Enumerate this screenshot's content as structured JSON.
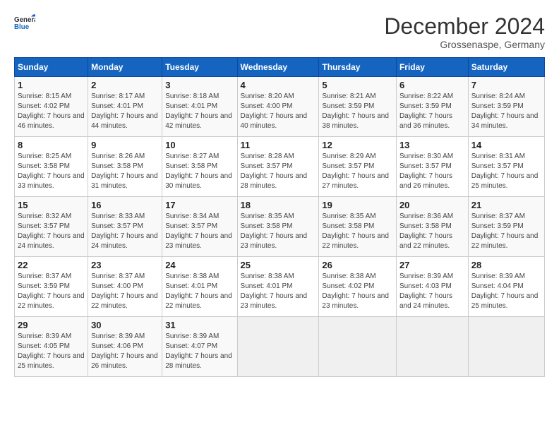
{
  "logo": {
    "text_general": "General",
    "text_blue": "Blue"
  },
  "title": "December 2024",
  "subtitle": "Grossenaspe, Germany",
  "days_of_week": [
    "Sunday",
    "Monday",
    "Tuesday",
    "Wednesday",
    "Thursday",
    "Friday",
    "Saturday"
  ],
  "weeks": [
    [
      {
        "day": "1",
        "sunrise": "Sunrise: 8:15 AM",
        "sunset": "Sunset: 4:02 PM",
        "daylight": "Daylight: 7 hours and 46 minutes."
      },
      {
        "day": "2",
        "sunrise": "Sunrise: 8:17 AM",
        "sunset": "Sunset: 4:01 PM",
        "daylight": "Daylight: 7 hours and 44 minutes."
      },
      {
        "day": "3",
        "sunrise": "Sunrise: 8:18 AM",
        "sunset": "Sunset: 4:01 PM",
        "daylight": "Daylight: 7 hours and 42 minutes."
      },
      {
        "day": "4",
        "sunrise": "Sunrise: 8:20 AM",
        "sunset": "Sunset: 4:00 PM",
        "daylight": "Daylight: 7 hours and 40 minutes."
      },
      {
        "day": "5",
        "sunrise": "Sunrise: 8:21 AM",
        "sunset": "Sunset: 3:59 PM",
        "daylight": "Daylight: 7 hours and 38 minutes."
      },
      {
        "day": "6",
        "sunrise": "Sunrise: 8:22 AM",
        "sunset": "Sunset: 3:59 PM",
        "daylight": "Daylight: 7 hours and 36 minutes."
      },
      {
        "day": "7",
        "sunrise": "Sunrise: 8:24 AM",
        "sunset": "Sunset: 3:59 PM",
        "daylight": "Daylight: 7 hours and 34 minutes."
      }
    ],
    [
      {
        "day": "8",
        "sunrise": "Sunrise: 8:25 AM",
        "sunset": "Sunset: 3:58 PM",
        "daylight": "Daylight: 7 hours and 33 minutes."
      },
      {
        "day": "9",
        "sunrise": "Sunrise: 8:26 AM",
        "sunset": "Sunset: 3:58 PM",
        "daylight": "Daylight: 7 hours and 31 minutes."
      },
      {
        "day": "10",
        "sunrise": "Sunrise: 8:27 AM",
        "sunset": "Sunset: 3:58 PM",
        "daylight": "Daylight: 7 hours and 30 minutes."
      },
      {
        "day": "11",
        "sunrise": "Sunrise: 8:28 AM",
        "sunset": "Sunset: 3:57 PM",
        "daylight": "Daylight: 7 hours and 28 minutes."
      },
      {
        "day": "12",
        "sunrise": "Sunrise: 8:29 AM",
        "sunset": "Sunset: 3:57 PM",
        "daylight": "Daylight: 7 hours and 27 minutes."
      },
      {
        "day": "13",
        "sunrise": "Sunrise: 8:30 AM",
        "sunset": "Sunset: 3:57 PM",
        "daylight": "Daylight: 7 hours and 26 minutes."
      },
      {
        "day": "14",
        "sunrise": "Sunrise: 8:31 AM",
        "sunset": "Sunset: 3:57 PM",
        "daylight": "Daylight: 7 hours and 25 minutes."
      }
    ],
    [
      {
        "day": "15",
        "sunrise": "Sunrise: 8:32 AM",
        "sunset": "Sunset: 3:57 PM",
        "daylight": "Daylight: 7 hours and 24 minutes."
      },
      {
        "day": "16",
        "sunrise": "Sunrise: 8:33 AM",
        "sunset": "Sunset: 3:57 PM",
        "daylight": "Daylight: 7 hours and 24 minutes."
      },
      {
        "day": "17",
        "sunrise": "Sunrise: 8:34 AM",
        "sunset": "Sunset: 3:57 PM",
        "daylight": "Daylight: 7 hours and 23 minutes."
      },
      {
        "day": "18",
        "sunrise": "Sunrise: 8:35 AM",
        "sunset": "Sunset: 3:58 PM",
        "daylight": "Daylight: 7 hours and 23 minutes."
      },
      {
        "day": "19",
        "sunrise": "Sunrise: 8:35 AM",
        "sunset": "Sunset: 3:58 PM",
        "daylight": "Daylight: 7 hours and 22 minutes."
      },
      {
        "day": "20",
        "sunrise": "Sunrise: 8:36 AM",
        "sunset": "Sunset: 3:58 PM",
        "daylight": "Daylight: 7 hours and 22 minutes."
      },
      {
        "day": "21",
        "sunrise": "Sunrise: 8:37 AM",
        "sunset": "Sunset: 3:59 PM",
        "daylight": "Daylight: 7 hours and 22 minutes."
      }
    ],
    [
      {
        "day": "22",
        "sunrise": "Sunrise: 8:37 AM",
        "sunset": "Sunset: 3:59 PM",
        "daylight": "Daylight: 7 hours and 22 minutes."
      },
      {
        "day": "23",
        "sunrise": "Sunrise: 8:37 AM",
        "sunset": "Sunset: 4:00 PM",
        "daylight": "Daylight: 7 hours and 22 minutes."
      },
      {
        "day": "24",
        "sunrise": "Sunrise: 8:38 AM",
        "sunset": "Sunset: 4:01 PM",
        "daylight": "Daylight: 7 hours and 22 minutes."
      },
      {
        "day": "25",
        "sunrise": "Sunrise: 8:38 AM",
        "sunset": "Sunset: 4:01 PM",
        "daylight": "Daylight: 7 hours and 23 minutes."
      },
      {
        "day": "26",
        "sunrise": "Sunrise: 8:38 AM",
        "sunset": "Sunset: 4:02 PM",
        "daylight": "Daylight: 7 hours and 23 minutes."
      },
      {
        "day": "27",
        "sunrise": "Sunrise: 8:39 AM",
        "sunset": "Sunset: 4:03 PM",
        "daylight": "Daylight: 7 hours and 24 minutes."
      },
      {
        "day": "28",
        "sunrise": "Sunrise: 8:39 AM",
        "sunset": "Sunset: 4:04 PM",
        "daylight": "Daylight: 7 hours and 25 minutes."
      }
    ],
    [
      {
        "day": "29",
        "sunrise": "Sunrise: 8:39 AM",
        "sunset": "Sunset: 4:05 PM",
        "daylight": "Daylight: 7 hours and 25 minutes."
      },
      {
        "day": "30",
        "sunrise": "Sunrise: 8:39 AM",
        "sunset": "Sunset: 4:06 PM",
        "daylight": "Daylight: 7 hours and 26 minutes."
      },
      {
        "day": "31",
        "sunrise": "Sunrise: 8:39 AM",
        "sunset": "Sunset: 4:07 PM",
        "daylight": "Daylight: 7 hours and 28 minutes."
      },
      null,
      null,
      null,
      null
    ]
  ]
}
